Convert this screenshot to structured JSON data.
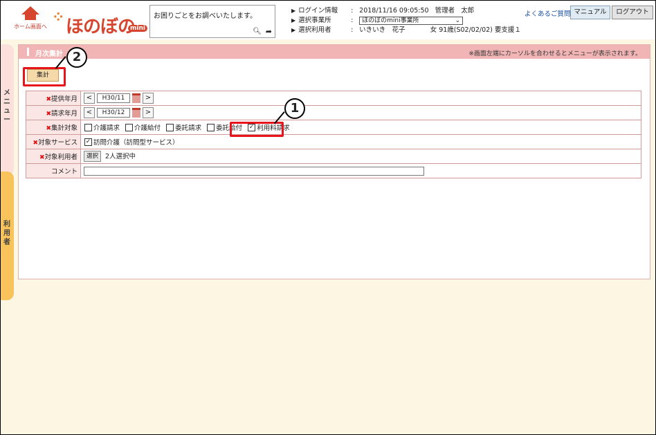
{
  "header": {
    "home_label": "ホーム画面へ",
    "logo_text": "ほのぼの",
    "logo_mini": "mini",
    "help_text": "お困りごとをお調べいたします。",
    "info": {
      "login_key": "ログイン情報",
      "login_datetime": "2018/11/16 09:05:50",
      "login_role": "管理者",
      "login_name": "太郎",
      "office_key": "選択事業所",
      "office_value": "ほのぼのmini事業所",
      "user_key": "選択利用者",
      "user_name": "いきいき　花子",
      "user_detail": "女 91歳(S02/02/02) 要支援１"
    },
    "faq_link": "よくあるご質問",
    "manual_btn": "マニュアル",
    "logout_btn": "ログアウト"
  },
  "side": {
    "menu_label": "メニュー",
    "user_label": "利用者"
  },
  "panel": {
    "title": "月次集計",
    "hint": "※画面左端にカーソルを合わせるとメニューが表示されます。",
    "aggregate_btn": "集計"
  },
  "form": {
    "provide_month": {
      "label": "提供年月",
      "value": "H30/11"
    },
    "bill_month": {
      "label": "請求年月",
      "value": "H30/12"
    },
    "target": {
      "label": "集計対象",
      "options": [
        {
          "label": "介護請求",
          "checked": false
        },
        {
          "label": "介護給付",
          "checked": false
        },
        {
          "label": "委託請求",
          "checked": false
        },
        {
          "label": "委託給付",
          "checked": false
        },
        {
          "label": "利用料請求",
          "checked": true
        }
      ]
    },
    "service": {
      "label": "対象サービス",
      "option": "訪問介護（訪問型サービス）",
      "checked": true
    },
    "users": {
      "label": "対象利用者",
      "select_btn": "選択",
      "summary": "2人選択中"
    },
    "comment": {
      "label": "コメント",
      "value": ""
    }
  },
  "annotations": {
    "circle1": "1",
    "circle2": "2"
  },
  "colors": {
    "accent": "#d6462f",
    "title_bar": "#f2b5b5",
    "callout": "#e8141b",
    "background": "#fdf6e3"
  }
}
